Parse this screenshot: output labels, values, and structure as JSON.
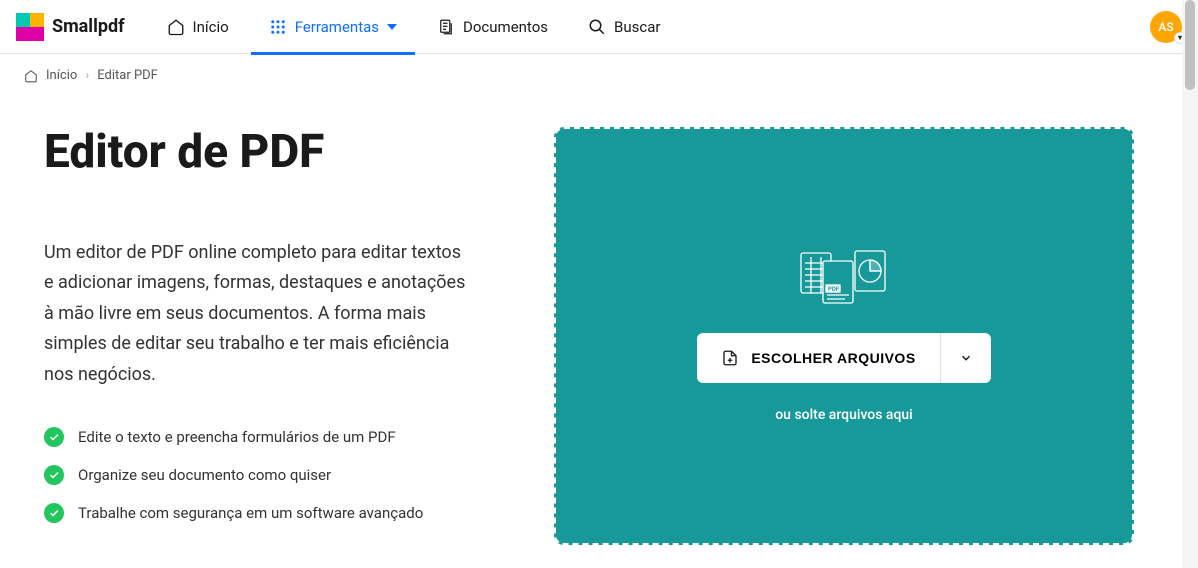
{
  "brand": "Smallpdf",
  "nav": {
    "home": "Início",
    "tools": "Ferramentas",
    "documents": "Documentos",
    "search": "Buscar"
  },
  "avatar_initials": "AS",
  "breadcrumb": {
    "home": "Início",
    "current": "Editar PDF"
  },
  "page_title": "Editor de PDF",
  "page_description": "Um editor de PDF online completo para editar textos e adicionar imagens, formas, destaques e anotações à mão livre em seus documentos. A forma mais simples de editar seu trabalho e ter mais eficiência nos negócios.",
  "features": [
    "Edite o texto e preencha formulários de um PDF",
    "Organize seu documento como quiser",
    "Trabalhe com segurança em um software avançado"
  ],
  "dropzone": {
    "choose_label": "ESCOLHER ARQUIVOS",
    "drop_hint": "ou solte arquivos aqui"
  },
  "colors": {
    "accent": "#0F6FFF",
    "dropzone": "#179999",
    "success": "#22C55E",
    "avatar": "#FFA500"
  }
}
